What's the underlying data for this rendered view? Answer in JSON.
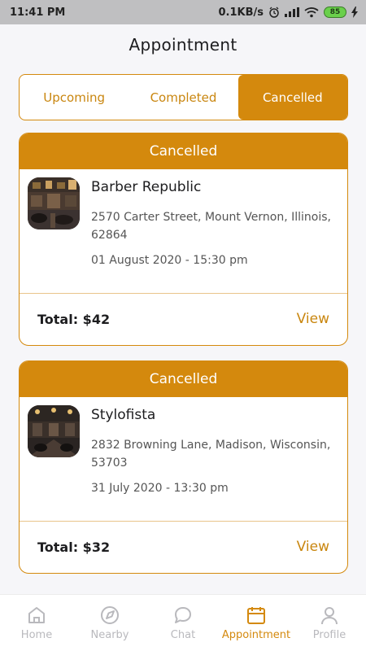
{
  "status_bar": {
    "time": "11:41 PM",
    "network_speed": "0.1KB/s",
    "battery": "85"
  },
  "header": {
    "title": "Appointment"
  },
  "tabs": [
    {
      "label": "Upcoming",
      "active": false
    },
    {
      "label": "Completed",
      "active": false
    },
    {
      "label": "Cancelled",
      "active": true
    }
  ],
  "appointments": [
    {
      "status": "Cancelled",
      "name": "Barber Republic",
      "address": "2570 Carter Street, Mount Vernon, Illinois, 62864",
      "datetime": "01 August 2020 - 15:30 pm",
      "total": "Total: $42",
      "action": "View"
    },
    {
      "status": "Cancelled",
      "name": "Stylofista",
      "address": "2832 Browning Lane, Madison, Wisconsin, 53703",
      "datetime": "31 July 2020 - 13:30 pm",
      "total": "Total: $32",
      "action": "View"
    }
  ],
  "bottom_nav": [
    {
      "label": "Home",
      "icon": "home-icon",
      "active": false
    },
    {
      "label": "Nearby",
      "icon": "compass-icon",
      "active": false
    },
    {
      "label": "Chat",
      "icon": "chat-icon",
      "active": false
    },
    {
      "label": "Appointment",
      "icon": "calendar-icon",
      "active": true
    },
    {
      "label": "Profile",
      "icon": "user-icon",
      "active": false
    }
  ],
  "colors": {
    "accent": "#d4890d",
    "inactive": "#b9b9bd",
    "background": "#f6f6f9"
  }
}
